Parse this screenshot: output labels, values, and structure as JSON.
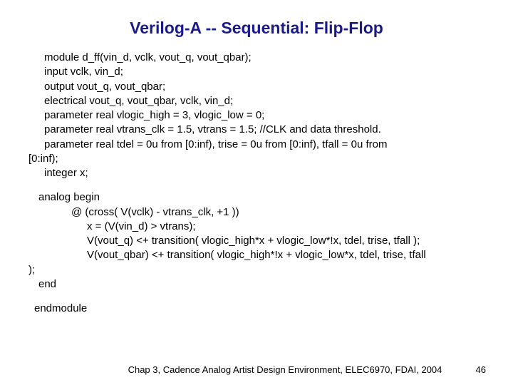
{
  "title": "Verilog-A -- Sequential: Flip-Flop",
  "code": {
    "l1": "module d_ff(vin_d, vclk, vout_q, vout_qbar);",
    "l2": "input vclk, vin_d;",
    "l3": "output vout_q, vout_qbar;",
    "l4": "electrical vout_q, vout_qbar, vclk, vin_d;",
    "l5": "parameter real vlogic_high = 3, vlogic_low = 0;",
    "l6": "parameter real vtrans_clk = 1.5, vtrans = 1.5; //CLK and data threshold.",
    "l7a": "parameter real tdel = 0u from [0:inf), trise = 0u from [0:inf), tfall = 0u from",
    "l7b": "[0:inf);",
    "l8": "integer x;",
    "l9": "analog begin",
    "l10": "@ (cross( V(vclk) - vtrans_clk, +1 ))",
    "l11": "x = (V(vin_d) > vtrans);",
    "l12": "V(vout_q) <+ transition( vlogic_high*x + vlogic_low*!x, tdel, trise, tfall );",
    "l13a": "V(vout_qbar) <+ transition( vlogic_high*!x + vlogic_low*x, tdel, trise, tfall",
    "l13b": ");",
    "l14": "end",
    "l15": "endmodule"
  },
  "footer": {
    "text": "Chap 3, Cadence Analog Artist Design Environment, ELEC6970, FDAI, 2004",
    "page": "46"
  }
}
